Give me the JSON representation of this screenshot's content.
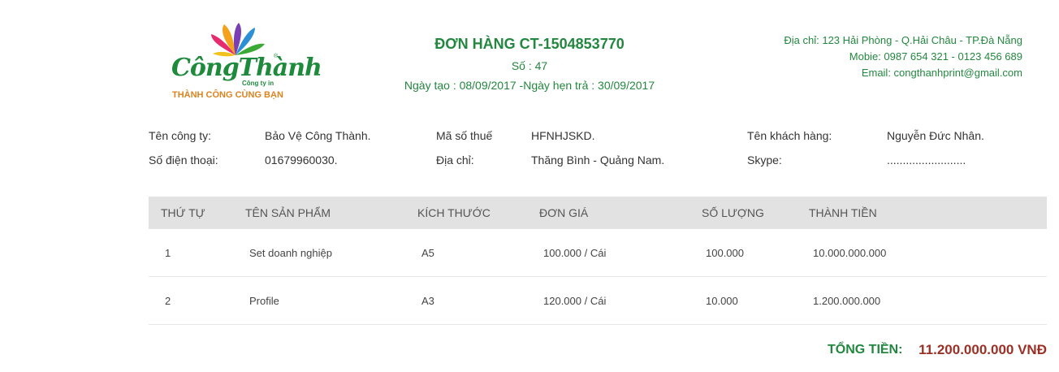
{
  "logo": {
    "script": "CôngThành",
    "reg": "®",
    "sub": "Công ty in",
    "slogan": "THÀNH CÔNG CÙNG BẠN"
  },
  "header": {
    "title": "ĐƠN HÀNG CT-1504853770",
    "number": "Số : 47",
    "dates": "Ngày tạo : 08/09/2017  -Ngày hẹn trả : 30/09/2017"
  },
  "contact": {
    "address": "Địa chỉ: 123 Hải Phòng - Q.Hải Châu - TP.Đà Nẵng",
    "mobile": "Mobie: 0987 654 321 - 0123 456 689",
    "email": "Email: congthanhprint@gmail.com"
  },
  "info": {
    "company_label": "Tên công ty:",
    "company_value": "Bảo Vệ Công Thành.",
    "tax_label": "Mã số thuế",
    "tax_value": "HFNHJSKD.",
    "customer_label": "Tên khách hàng:",
    "customer_value": "Nguyễn Đức Nhân.",
    "phone_label": "Số điện thoại:",
    "phone_value": "01679960030.",
    "address_label": "Địa chỉ:",
    "address_value": "Thăng Bình - Quảng Nam.",
    "skype_label": "Skype:",
    "skype_value": "........................."
  },
  "table": {
    "headers": [
      "THỨ TỰ",
      "TÊN SẢN PHẨM",
      "KÍCH THƯỚC",
      "ĐƠN GIÁ",
      "SỐ LƯỢNG",
      "THÀNH TIỀN"
    ],
    "rows": [
      [
        "1",
        "Set doanh nghiệp",
        "A5",
        "100.000 / Cái",
        "100.000",
        "10.000.000.000"
      ],
      [
        "2",
        "Profile",
        "A3",
        "120.000 / Cái",
        "10.000",
        "1.200.000.000"
      ]
    ]
  },
  "total": {
    "label": "TỔNG TIỀN:",
    "value": "11.200.000.000 VNĐ"
  },
  "colors": {
    "brand_green": "#23873f",
    "total_red": "#9b3026",
    "header_bg": "#e2e2e2",
    "slogan_orange": "#d9841f"
  }
}
